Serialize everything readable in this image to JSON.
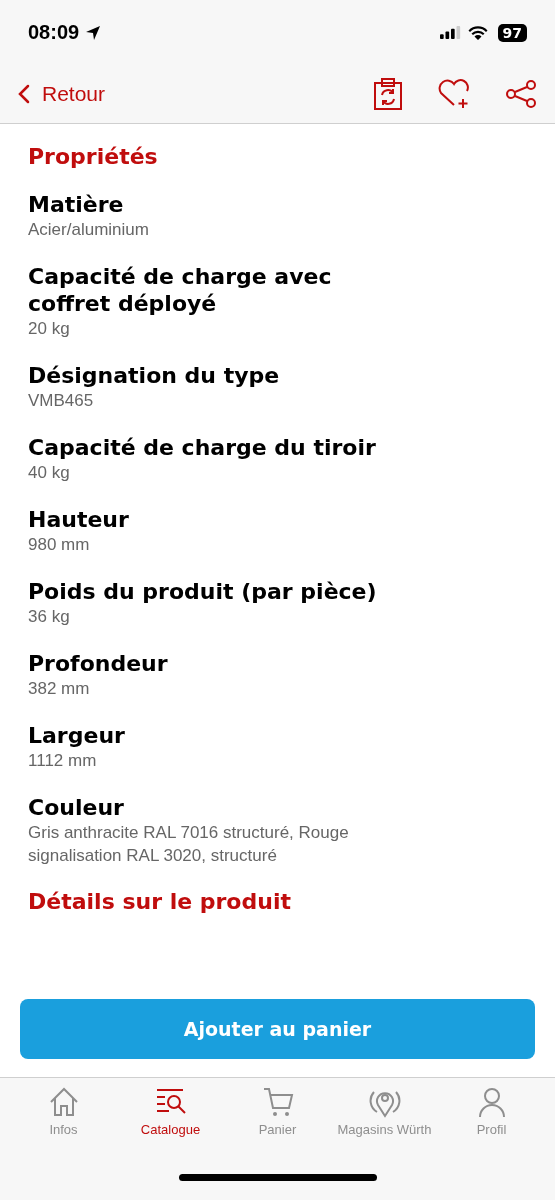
{
  "status_bar": {
    "time": "08:09",
    "battery": "97"
  },
  "nav": {
    "back": "Retour"
  },
  "section_title": "Propriétés",
  "properties": [
    {
      "name": "Matière",
      "value": "Acier/aluminium"
    },
    {
      "name": "Capacité de charge avec coffret déployé",
      "value": "20 kg"
    },
    {
      "name": "Désignation du type",
      "value": "VMB465"
    },
    {
      "name": "Capacité de charge du tiroir",
      "value": "40 kg"
    },
    {
      "name": "Hauteur",
      "value": "980 mm"
    },
    {
      "name": "Poids du produit (par pièce)",
      "value": "36 kg"
    },
    {
      "name": "Profondeur",
      "value": "382 mm"
    },
    {
      "name": "Largeur",
      "value": "1112 mm"
    },
    {
      "name": "Couleur",
      "value": "Gris anthracite RAL 7016 structuré, Rouge signalisation RAL 3020, structuré"
    }
  ],
  "details_title": "Détails sur le produit",
  "add_button": "Ajouter au panier",
  "tabs": [
    {
      "label": "Infos",
      "kind": "home",
      "selected": false
    },
    {
      "label": "Catalogue",
      "kind": "catalog",
      "selected": true
    },
    {
      "label": "Panier",
      "kind": "cart",
      "selected": false
    },
    {
      "label": "Magasins Würth",
      "kind": "store",
      "selected": false
    },
    {
      "label": "Profil",
      "kind": "profile",
      "selected": false
    }
  ]
}
